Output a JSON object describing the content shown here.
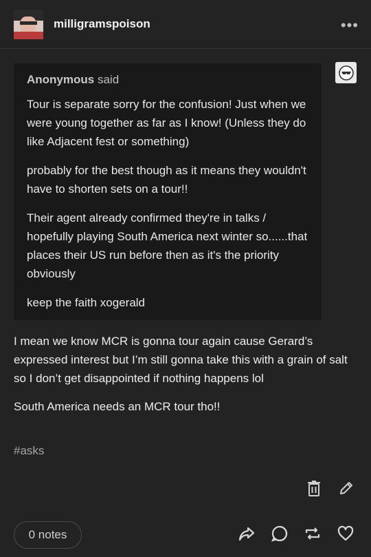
{
  "post": {
    "username": "milligramspoison",
    "more_label": "•••"
  },
  "ask": {
    "asker": "Anonymous",
    "said": "said",
    "paragraphs": [
      "Tour is separate sorry for the confusion! Just when we were young together as far as I know! (Unless they do like Adjacent fest or something)",
      "probably for the best though as it means they wouldn't have to shorten sets on a tour!!",
      "Their agent already confirmed they're in talks / hopefully playing South America next winter so......that places their US run before then as it's the priority obviously",
      "keep the faith xogerald"
    ]
  },
  "answer": {
    "paragraphs": [
      "I mean we know MCR is gonna tour again cause Gerard’s expressed interest but I’m still gonna take this with a grain of salt so I don’t get disappointed if nothing happens lol",
      "South America needs an MCR tour tho!!"
    ]
  },
  "tags": [
    "#asks"
  ],
  "footer": {
    "notes_label": "0 notes"
  },
  "icons": {
    "avatar": "user-avatar",
    "badge": "anonymous-sunglasses-icon",
    "delete": "trash-icon",
    "edit": "pencil-icon",
    "share": "share-icon",
    "reply": "reply-bubble-icon",
    "reblog": "reblog-icon",
    "like": "heart-icon"
  },
  "colors": {
    "background": "#232323",
    "quote_background": "#191919",
    "text": "#e6e6e6",
    "muted": "#a6a6a6"
  }
}
